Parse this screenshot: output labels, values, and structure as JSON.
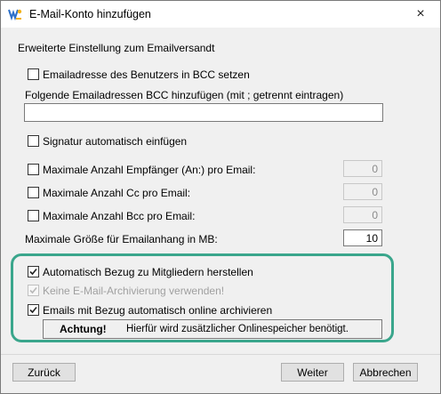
{
  "window": {
    "title": "E-Mail-Konto hinzufügen",
    "close_icon": "×"
  },
  "section": {
    "label": "Erweiterte Einstellung zum Emailversandt"
  },
  "options": {
    "bcc_self": {
      "label": "Emailadresse des Benutzers in BCC setzen",
      "checked": false
    },
    "bcc_list_label": "Folgende Emailadressen BCC hinzufügen (mit ; getrennt eintragen)",
    "bcc_list_value": "",
    "signature": {
      "label": "Signatur automatisch einfügen",
      "checked": false
    },
    "max_to": {
      "label": "Maximale Anzahl Empfänger (An:) pro Email:",
      "checked": false,
      "value": "0"
    },
    "max_cc": {
      "label": "Maximale Anzahl Cc pro Email:",
      "checked": false,
      "value": "0"
    },
    "max_bcc": {
      "label": "Maximale Anzahl Bcc pro Email:",
      "checked": false,
      "value": "0"
    },
    "max_size_label": "Maximale Größe für Emailanhang in MB:",
    "max_size_value": "10",
    "auto_relation": {
      "label": "Automatisch Bezug zu Mitgliedern herstellen",
      "checked": true
    },
    "no_archive": {
      "label": "Keine E-Mail-Archivierung verwenden!",
      "checked": true,
      "disabled": true
    },
    "auto_archive": {
      "label": "Emails mit Bezug automatisch online archivieren",
      "checked": true
    }
  },
  "note": {
    "bold": "Achtung!",
    "text": "Hierfür wird zusätzlicher Onlinespeicher benötigt."
  },
  "buttons": {
    "back": "Zurück",
    "next": "Weiter",
    "cancel": "Abbrechen"
  },
  "colors": {
    "highlight": "#3aa68c"
  }
}
